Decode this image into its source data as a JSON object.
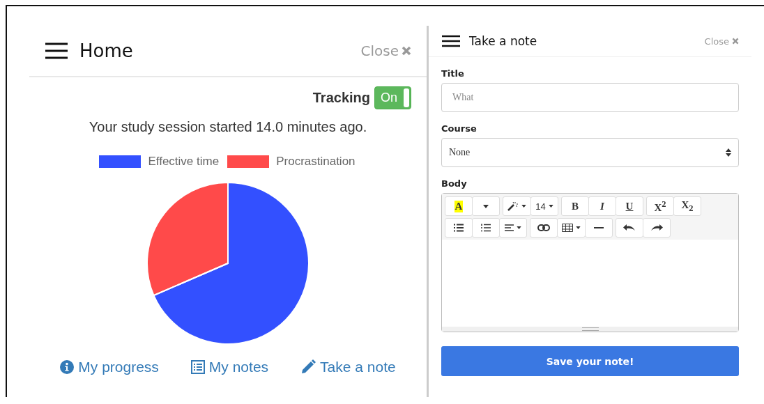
{
  "home": {
    "title": "Home",
    "close": "Close",
    "tracking": {
      "label": "Tracking",
      "on": true,
      "state_text": "On"
    },
    "session_text": "Your study session started 14.0 minutes ago.",
    "legend": [
      {
        "color": "#3350ff"
      },
      {
        "color": "#ff4a4a"
      }
    ],
    "chart_data": {
      "type": "pie",
      "categories": [
        "Effective time",
        "Procrastination"
      ],
      "series": [
        {
          "values": [
            68.5,
            31.5
          ]
        }
      ]
    },
    "links": [
      {
        "kind": "info",
        "label": "My progress"
      },
      {
        "kind": "list",
        "label": "My notes"
      },
      {
        "kind": "pencil",
        "label": "Take a note"
      }
    ]
  },
  "note": {
    "title": "Take a note",
    "close": "Close",
    "title_label": "Title",
    "title_placeholder": "What",
    "course_label": "Course",
    "course_value": "None",
    "body_label": "Body",
    "toolbar": [
      [
        [
          {
            "label": "A",
            "kind": "highlight"
          },
          {
            "kind": "caret"
          }
        ],
        [
          {
            "kind": "wand",
            "caret": true
          },
          {
            "label": "14",
            "kind": "plain",
            "caret": true
          }
        ],
        [
          {
            "label": "B",
            "kind": "bold"
          },
          {
            "label": "I",
            "kind": "italic"
          },
          {
            "label": "U",
            "kind": "underline"
          }
        ],
        [
          {
            "label": "X$^{2}$",
            "kind": "bold"
          },
          {
            "label": "X$_{2}$",
            "kind": "bold"
          }
        ]
      ],
      [
        [
          {
            "kind": "ul"
          },
          {
            "kind": "ol"
          },
          {
            "kind": "align",
            "caret": true
          }
        ],
        [
          {
            "kind": "link"
          },
          {
            "kind": "table",
            "caret": true
          },
          {
            "kind": "hr"
          }
        ],
        [
          {
            "kind": "undo"
          },
          {
            "kind": "redo"
          }
        ]
      ]
    ],
    "save": "Save your note!"
  }
}
